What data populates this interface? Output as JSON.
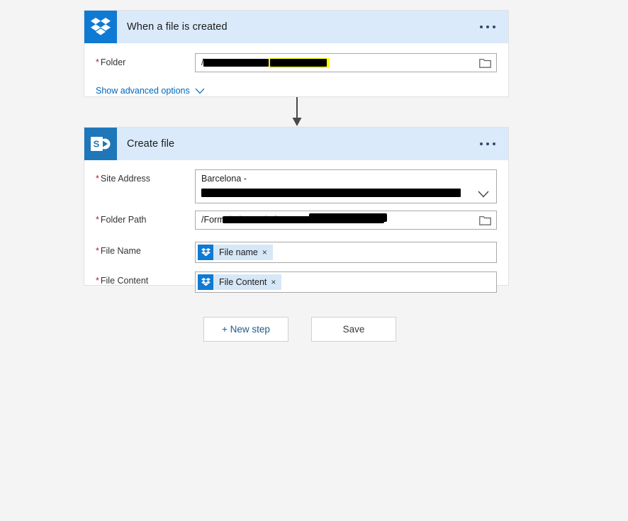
{
  "theme": {
    "page_background": "#f4f4f4",
    "card_background": "#ffffff",
    "card_header_background": "#daeafa",
    "dropbox_brand": "#0f7ad4",
    "sharepoint_brand": "#1e77b8",
    "required_asterisk_color": "#a4262c",
    "link_color": "#0066bb",
    "redaction_color": "#000000",
    "highlight_color": "#ffff00"
  },
  "trigger_card": {
    "connector_icon": "dropbox-icon",
    "title": "When a file is created",
    "overflow_menu_label": "...",
    "fields": [
      {
        "label": "Folder",
        "required": true,
        "value_prefix": "/",
        "value_redacted": true,
        "has_highlight": true,
        "trailing_icon": "folder-picker-icon"
      }
    ],
    "advanced_options_label": "Show advanced options",
    "advanced_options_icon": "chevron-down-icon"
  },
  "action_card": {
    "connector_icon": "sharepoint-icon",
    "title": "Create file",
    "overflow_menu_label": "...",
    "fields": [
      {
        "label": "Site Address",
        "required": true,
        "value_line1": "Barcelona -",
        "value_line2_redacted": true,
        "trailing_icon": "chevron-down-icon"
      },
      {
        "label": "Folder Path",
        "required": true,
        "value_prefix": "/Formularios 6S/Inf",
        "value_redacted": true,
        "trailing_icon": "folder-picker-icon"
      },
      {
        "label": "File Name",
        "required": true,
        "token": {
          "icon": "dropbox-icon",
          "label": "File name",
          "remove_label": "×"
        }
      },
      {
        "label": "File Content",
        "required": true,
        "token": {
          "icon": "dropbox-icon",
          "label": "File Content",
          "remove_label": "×"
        }
      }
    ]
  },
  "connector_arrow": {
    "icon": "arrow-down-icon"
  },
  "footer": {
    "new_step_label": "+ New step",
    "save_label": "Save"
  }
}
